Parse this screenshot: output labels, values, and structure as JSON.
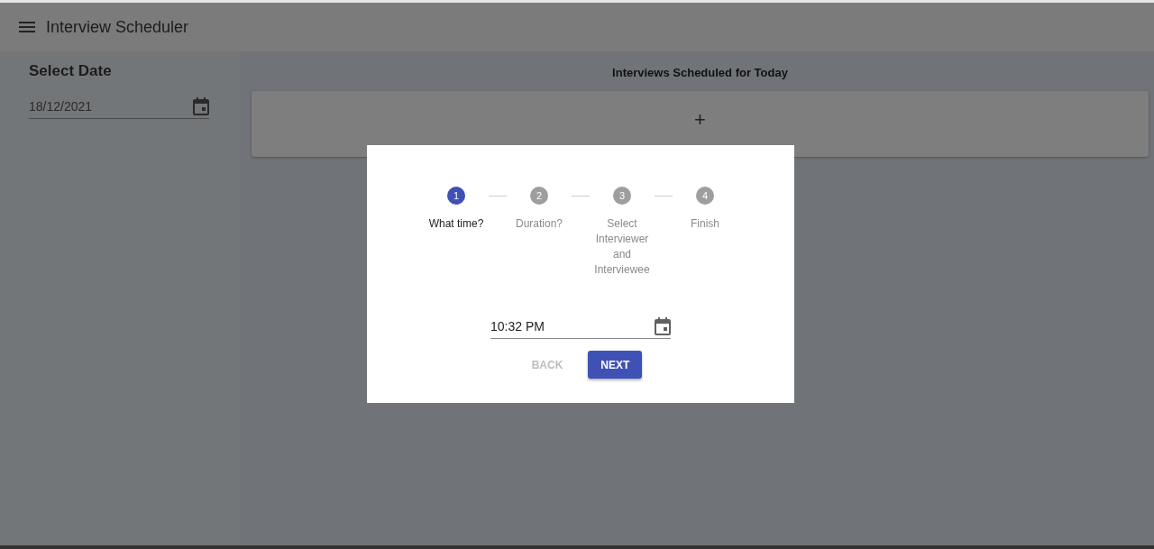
{
  "app_bar": {
    "title": "Interview Scheduler"
  },
  "sidebar": {
    "heading": "Select Date",
    "date_field": {
      "value": "18/12/2021"
    }
  },
  "main": {
    "heading": "Interviews Scheduled for Today",
    "add_card": {
      "label": "+"
    }
  },
  "dialog": {
    "steps": [
      {
        "number": "1",
        "label": "What time?",
        "selected": true
      },
      {
        "number": "2",
        "label": "Duration?",
        "selected": false
      },
      {
        "number": "3",
        "label": "Select Interviewer and Interviewee",
        "selected": false
      },
      {
        "number": "4",
        "label": "Finish",
        "selected": false
      }
    ],
    "time_field": {
      "value": "10:32 PM"
    },
    "buttons": [
      {
        "label": "BACK",
        "disabled": true
      },
      {
        "label": "NEXT",
        "disabled": false
      }
    ]
  }
}
